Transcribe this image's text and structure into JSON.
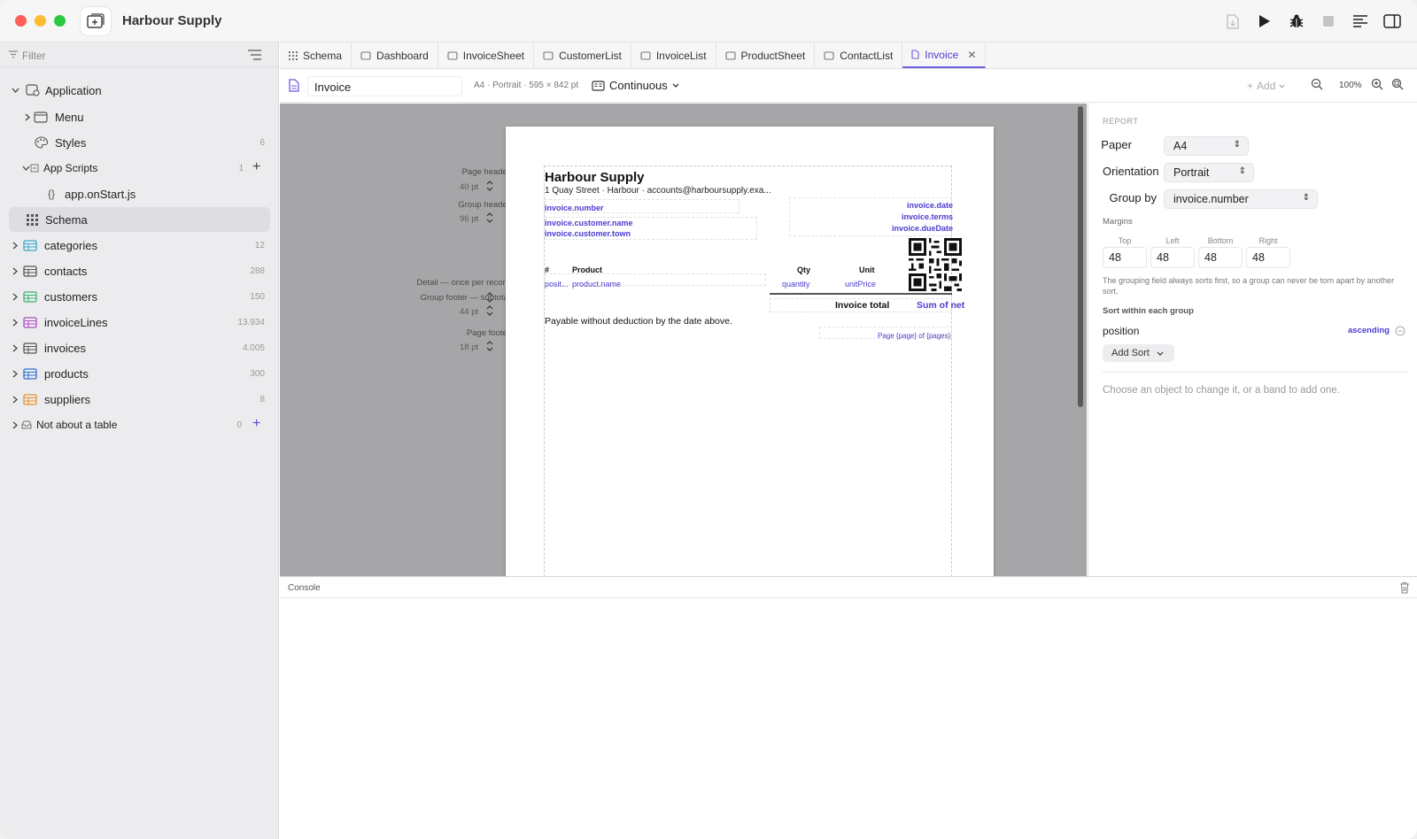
{
  "app": {
    "title": "Harbour Supply"
  },
  "sidebar": {
    "filter_placeholder": "Filter",
    "application": "Application",
    "menu": "Menu",
    "styles": {
      "label": "Styles",
      "count": "6"
    },
    "app_scripts": {
      "label": "App Scripts",
      "count": "1"
    },
    "script": "app.onStart.js",
    "schema": "Schema",
    "tables": [
      {
        "label": "categories",
        "count": "12",
        "color": "#3aa7c9"
      },
      {
        "label": "contacts",
        "count": "288",
        "color": "#555555"
      },
      {
        "label": "customers",
        "count": "150",
        "color": "#3cb371"
      },
      {
        "label": "invoiceLines",
        "count": "13.934",
        "color": "#b04fc4"
      },
      {
        "label": "invoices",
        "count": "4.005",
        "color": "#555555"
      },
      {
        "label": "products",
        "count": "300",
        "color": "#2f6fd0"
      },
      {
        "label": "suppliers",
        "count": "8",
        "color": "#e8902a"
      }
    ],
    "not_table": {
      "label": "Not about a table",
      "count": "0"
    }
  },
  "tabs": [
    "Schema",
    "Dashboard",
    "InvoiceSheet",
    "CustomerList",
    "InvoiceList",
    "ProductSheet",
    "ContactList",
    "Invoice"
  ],
  "toolbar": {
    "report_name": "Invoice",
    "page_info": "A4 · Portrait · 595 × 842 pt",
    "view_mode": "Continuous",
    "add_label": "Add",
    "zoom": "100%"
  },
  "bands": {
    "page_header": {
      "label": "Page header",
      "pt": "40 pt"
    },
    "group_header": {
      "label": "Group header",
      "pt": "96 pt"
    },
    "detail": {
      "label": "Detail — once per record",
      "pt": ""
    },
    "group_footer": {
      "label": "Group footer — subtotal",
      "pt": "44 pt"
    },
    "page_footer": {
      "label": "Page footer",
      "pt": "18 pt"
    }
  },
  "invoice": {
    "company": "Harbour Supply",
    "address": "1 Quay Street · Harbour · accounts@harboursupply.exa...",
    "number": "invoice.number",
    "customer_name": "invoice.customer.name",
    "customer_town": "invoice.customer.town",
    "date": "invoice.date",
    "terms": "invoice.terms",
    "due_date": "invoice.dueDate",
    "columns": {
      "pos": "#",
      "product": "Product",
      "qty": "Qty",
      "unit": "Unit"
    },
    "detail": {
      "pos": "posit...",
      "product": "product.name",
      "qty": "quantity",
      "unit": "unitPrice"
    },
    "total_label": "Invoice total",
    "total_value": "Sum of net",
    "payable": "Payable without deduction by the date above.",
    "page_number": "Page {page} of {pages}"
  },
  "inspector": {
    "section": "REPORT",
    "paper_label": "Paper",
    "paper": "A4",
    "orientation_label": "Orientation",
    "orientation": "Portrait",
    "group_label": "Group by",
    "group": "invoice.number",
    "margins_label": "Margins",
    "margins": [
      {
        "label": "Top",
        "value": "48"
      },
      {
        "label": "Left",
        "value": "48"
      },
      {
        "label": "Bottom",
        "value": "48"
      },
      {
        "label": "Right",
        "value": "48"
      }
    ],
    "note": "The grouping field always sorts first, so a group can never be torn apart by another sort.",
    "sort_label": "Sort within each group",
    "sort_field": "position",
    "sort_dir": "ascending",
    "add_sort": "Add Sort",
    "hint": "Choose an object to change it, or a band to add one."
  },
  "console": {
    "title": "Console"
  }
}
